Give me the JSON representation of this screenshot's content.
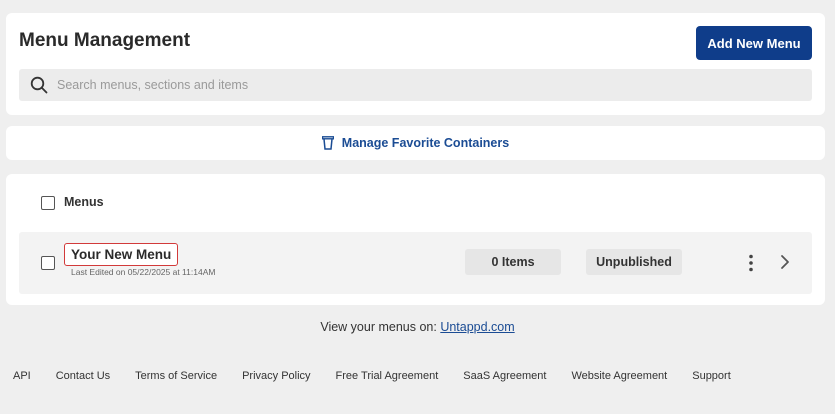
{
  "header": {
    "title": "Menu Management",
    "add_button_label": "Add New Menu",
    "search_placeholder": "Search menus, sections and items"
  },
  "favorites": {
    "label": "Manage Favorite Containers",
    "icon": "trash-cup-icon"
  },
  "menus": {
    "column_label": "Menus",
    "rows": [
      {
        "name": "Your New Menu",
        "last_edited": "Last Edited on 05/22/2025 at 11:14AM",
        "items": "0 Items",
        "status": "Unpublished"
      }
    ]
  },
  "view_line": {
    "prefix": "View your menus on: ",
    "link": "Untappd.com"
  },
  "footer": {
    "links": [
      "API",
      "Contact Us",
      "Terms of Service",
      "Privacy Policy",
      "Free Trial Agreement",
      "SaaS Agreement",
      "Website Agreement",
      "Support"
    ]
  },
  "colors": {
    "primary": "#0f3d8a",
    "link": "#1b4c94",
    "highlight_border": "#d23a3a",
    "background": "#efefef"
  }
}
